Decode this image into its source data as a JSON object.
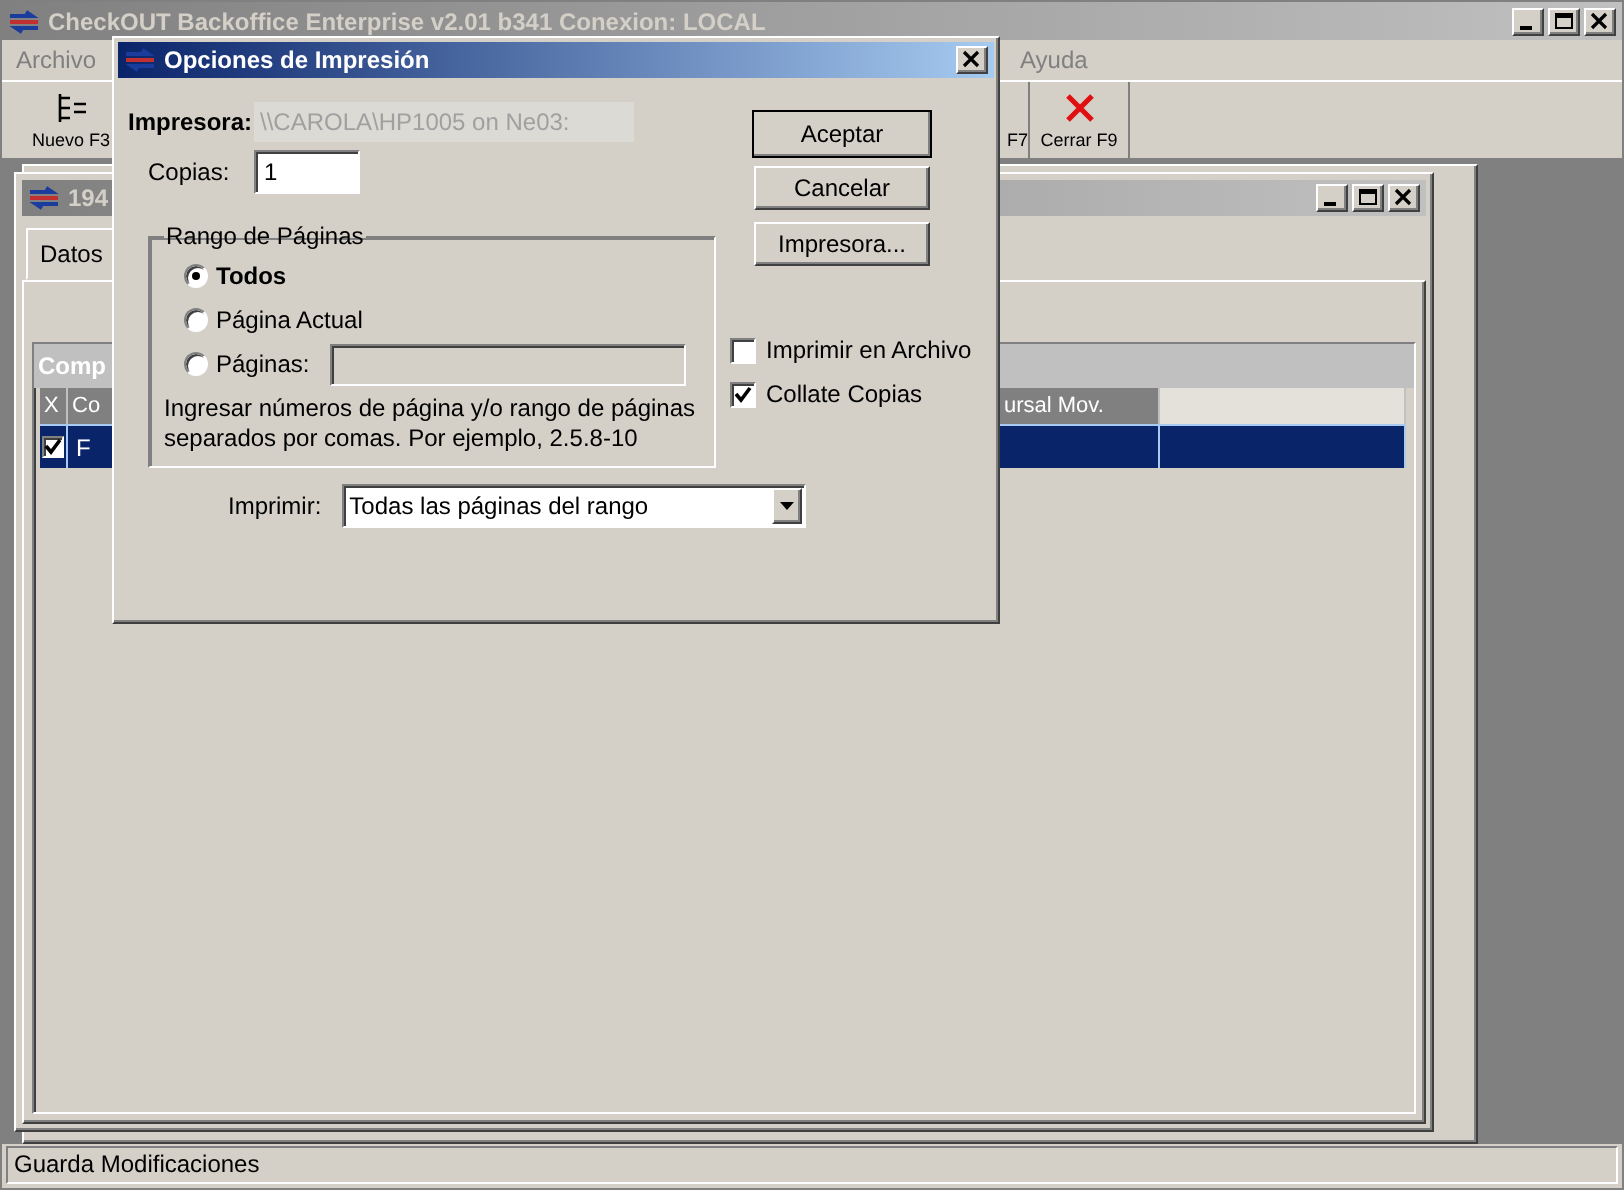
{
  "main_window": {
    "title": "CheckOUT Backoffice Enterprise v2.01 b341 Conexion: LOCAL",
    "active": false
  },
  "menu": [
    "Archivo",
    "Ayuda"
  ],
  "toolbar": [
    {
      "label": "Nuevo F3",
      "kind": "new"
    },
    {
      "label": "F7",
      "kind": "partial"
    },
    {
      "label": "Cerrar F9",
      "kind": "close"
    }
  ],
  "child_window": {
    "title": "194",
    "tabs": [
      {
        "label": "Datos",
        "selected": true
      }
    ],
    "grid": {
      "title": "Comp",
      "columns": [
        "X",
        "Co",
        "ursal Mov."
      ],
      "rows": [
        {
          "checked": true,
          "selected": true,
          "cells": [
            "",
            "F"
          ]
        }
      ]
    }
  },
  "dialog": {
    "title": "Opciones de Impresión",
    "printer_label": "Impresora:",
    "printer_value": "\\\\CAROLA\\HP1005 on Ne03:",
    "copies_label": "Copias:",
    "copies_value": "1",
    "range": {
      "title": "Rango de Páginas",
      "options": [
        {
          "label": "Todos",
          "selected": true,
          "kind": "plain"
        },
        {
          "label": "Página Actual",
          "selected": false,
          "kind": "plain"
        },
        {
          "label": "Páginas:",
          "selected": false,
          "kind": "pages"
        }
      ],
      "hint": "Ingresar números de página y/o rango de páginas separados por comas. Por ejemplo, 2.5.8-10"
    },
    "buttons": [
      {
        "label": "Aceptar",
        "default": true
      },
      {
        "label": "Cancelar",
        "default": false
      },
      {
        "label": "Impresora...",
        "default": false
      }
    ],
    "checkboxes": [
      {
        "label": "Imprimir en Archivo",
        "checked": false
      },
      {
        "label": "Collate Copias",
        "checked": true
      }
    ],
    "print_label": "Imprimir:",
    "print_value": "Todas las páginas del rango"
  },
  "status_bar": "Guarda Modificaciones"
}
